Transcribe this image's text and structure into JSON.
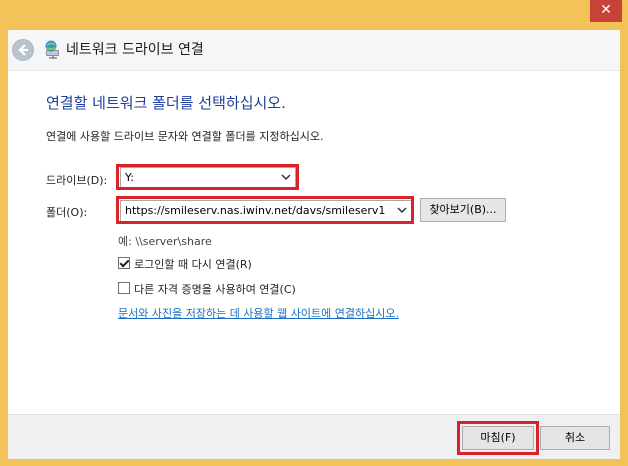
{
  "window": {
    "title": "네트워크 드라이브 연결",
    "close_glyph": "✕"
  },
  "content": {
    "heading": "연결할 네트워크 폴더를 선택하십시오.",
    "description": "연결에 사용할 드라이브 문자와 연결할 폴더를 지정하십시오.",
    "drive_label": "드라이브(D):",
    "drive_value": "Y:",
    "folder_label": "폴더(O):",
    "folder_value": "https://smileserv.nas.iwinv.net/davs/smileserv1",
    "browse_button": "찾아보기(B)...",
    "example": "예: \\\\server\\share",
    "reconnect_label": "로그인할 때 다시 연결(R)",
    "reconnect_checked": true,
    "credentials_label": "다른 자격 증명을 사용하여 연결(C)",
    "credentials_checked": false,
    "website_link": "문서와 사진을 저장하는 데 사용할 웹 사이트에 연결하십시오."
  },
  "footer": {
    "finish_button": "마침(F)",
    "cancel_button": "취소"
  },
  "colors": {
    "frame": "#f3c35a",
    "close": "#c7433a",
    "heading": "#1f3f99",
    "link": "#1a6fc4",
    "highlight": "#d8232a"
  },
  "icons": {
    "back": "back-arrow-icon",
    "network": "network-drive-icon",
    "dropdown": "chevron-down-icon"
  }
}
